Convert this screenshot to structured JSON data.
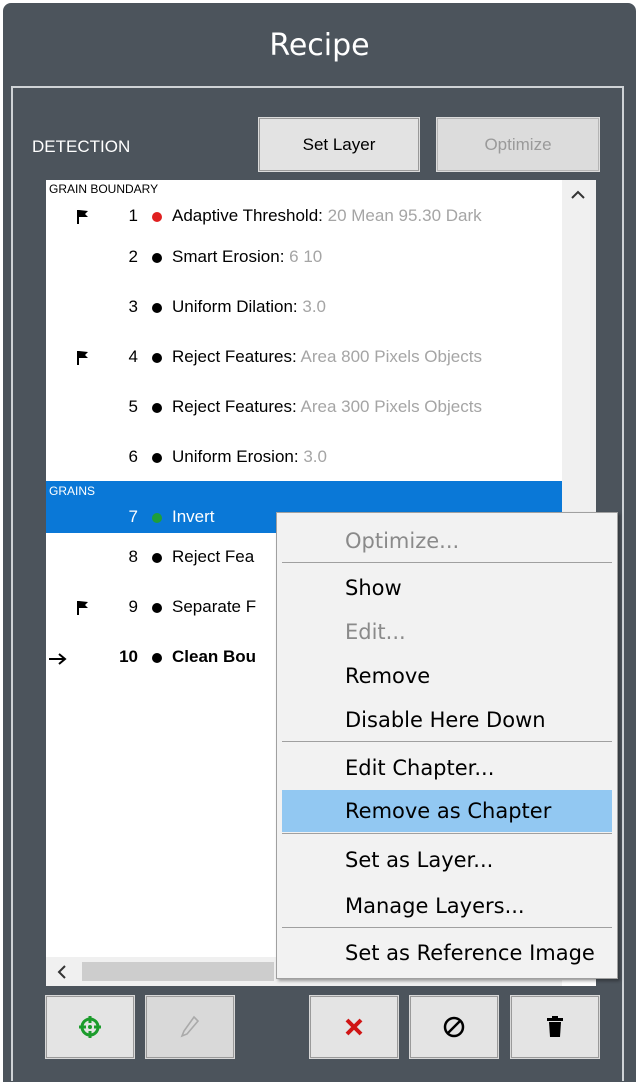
{
  "window": {
    "title": "Recipe"
  },
  "detection": {
    "label": "DETECTION",
    "set_layer_label": "Set Layer",
    "optimize_label": "Optimize"
  },
  "groups": [
    {
      "name": "GRAIN BOUNDARY",
      "steps": [
        {
          "num": "1",
          "status": "red",
          "flag": true,
          "name": "Adaptive Threshold:",
          "params": " 20 Mean 95.30 Dark"
        },
        {
          "num": "2",
          "status": "black",
          "flag": false,
          "name": "Smart Erosion:",
          "params": " 6 10"
        },
        {
          "num": "3",
          "status": "black",
          "flag": false,
          "name": "Uniform Dilation:",
          "params": " 3.0"
        },
        {
          "num": "4",
          "status": "black",
          "flag": true,
          "name": "Reject Features:",
          "params": " Area 800 Pixels Objects"
        },
        {
          "num": "5",
          "status": "black",
          "flag": false,
          "name": "Reject Features:",
          "params": " Area 300 Pixels Objects"
        },
        {
          "num": "6",
          "status": "black",
          "flag": false,
          "name": "Uniform Erosion:",
          "params": " 3.0"
        }
      ]
    },
    {
      "name": "GRAINS",
      "steps": [
        {
          "num": "7",
          "status": "green",
          "flag": false,
          "name": "Invert",
          "params": ""
        },
        {
          "num": "8",
          "status": "black",
          "flag": false,
          "name": "Reject Fea",
          "params": ""
        },
        {
          "num": "9",
          "status": "black",
          "flag": true,
          "name": "Separate F",
          "params": ""
        },
        {
          "num": "10",
          "status": "black",
          "flag": false,
          "current": true,
          "name": "Clean Bou",
          "params": ""
        }
      ]
    }
  ],
  "context_menu": {
    "items": [
      {
        "label": "Optimize...",
        "enabled": false
      },
      {
        "label": "Show",
        "enabled": true
      },
      {
        "label": "Edit...",
        "enabled": false
      },
      {
        "label": "Remove",
        "enabled": true
      },
      {
        "label": "Disable Here Down",
        "enabled": true
      },
      {
        "label": "Edit Chapter...",
        "enabled": true
      },
      {
        "label": "Remove as Chapter",
        "enabled": true,
        "highlighted": true
      },
      {
        "label": "Set as Layer...",
        "enabled": true
      },
      {
        "label": "Manage Layers...",
        "enabled": true
      },
      {
        "label": "Set as Reference Image",
        "enabled": true
      }
    ]
  },
  "toolbar": {
    "buttons": [
      {
        "icon": "target-add-icon",
        "enabled": true
      },
      {
        "icon": "pencil-icon",
        "enabled": false
      },
      {
        "icon": "delete-x-icon",
        "enabled": true
      },
      {
        "icon": "disable-icon",
        "enabled": true
      },
      {
        "icon": "trash-icon",
        "enabled": true
      }
    ]
  },
  "colors": {
    "panel_bg": "#4c545c",
    "selection": "#0a78d7",
    "menu_highlight": "#92c8f2",
    "status_red": "#e02020",
    "status_green": "#1e9e3a",
    "delete_red": "#d01515",
    "add_green": "#1c9c2c"
  }
}
